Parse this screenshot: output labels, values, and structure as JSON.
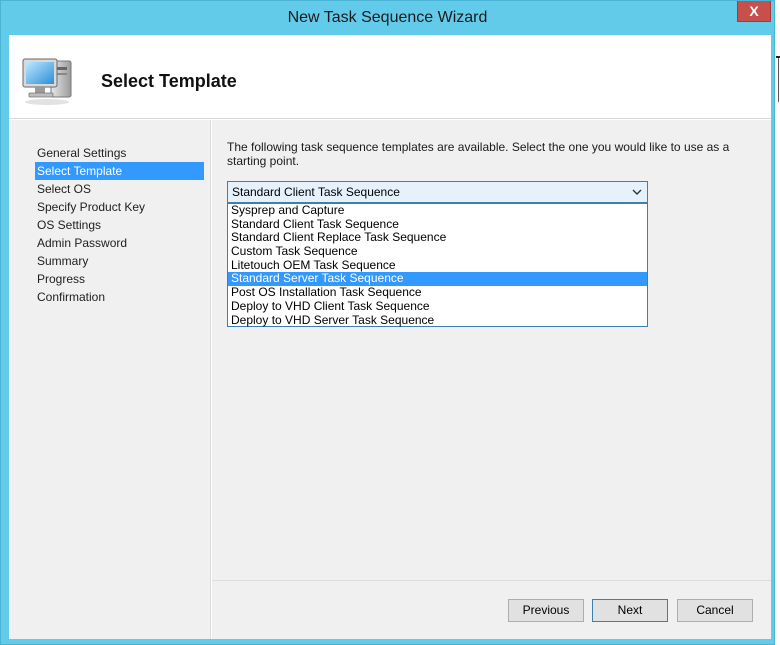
{
  "window": {
    "title": "New Task Sequence Wizard",
    "close_label": "X"
  },
  "header": {
    "title": "Select Template",
    "icon": "computer-icon"
  },
  "nav": {
    "items": [
      {
        "label": "General Settings"
      },
      {
        "label": "Select Template",
        "selected": true
      },
      {
        "label": "Select OS"
      },
      {
        "label": "Specify Product Key"
      },
      {
        "label": "OS Settings"
      },
      {
        "label": "Admin Password"
      },
      {
        "label": "Summary"
      },
      {
        "label": "Progress"
      },
      {
        "label": "Confirmation"
      }
    ]
  },
  "main": {
    "description": "The following task sequence templates are available.  Select the one you would like to use as a starting point.",
    "template_select": {
      "value": "Standard Client Task Sequence",
      "options": [
        "Sysprep and Capture",
        "Standard Client Task Sequence",
        "Standard Client Replace Task Sequence",
        "Custom Task Sequence",
        "Litetouch OEM Task Sequence",
        "Standard Server Task Sequence",
        "Post OS Installation Task Sequence",
        "Deploy to VHD Client Task Sequence",
        "Deploy to VHD Server Task Sequence"
      ],
      "highlighted": "Standard Server Task Sequence"
    }
  },
  "footer": {
    "previous_label": "Previous",
    "next_label": "Next",
    "cancel_label": "Cancel"
  },
  "colors": {
    "title_bar": "#63cbea",
    "close_button": "#c7504c",
    "selection": "#3399ff",
    "combo_background": "#e5f1fb"
  }
}
